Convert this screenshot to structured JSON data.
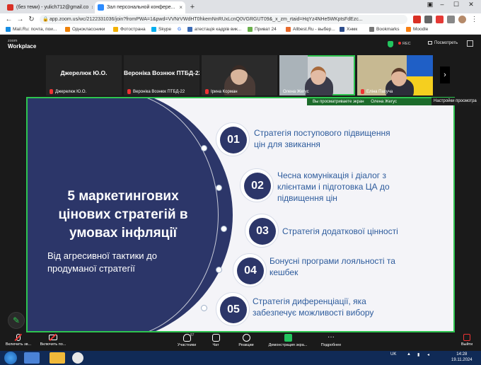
{
  "browser": {
    "tabs": [
      {
        "label": "(без теми) - yulich712@gmail.co",
        "favicon_color": "#d93025"
      },
      {
        "label": "Зал персональной конфере...",
        "favicon_color": "#2d8cff"
      }
    ],
    "new_tab": "+",
    "url": "app.zoom.us/wc/2122331036/join?fromPWA=1&pwd=VVNrVWdHT0hkemNnRUxLcnQ0VGRGUT09&_x_zm_rtaid=HqYz4NHe5WKptsFdEzc...",
    "bookmarks": [
      {
        "label": "Mail.Ru: почта, пои...",
        "color": "#168de2"
      },
      {
        "label": "Одноклассники",
        "color": "#ee8208"
      },
      {
        "label": "Фотострана",
        "color": "#f2b100"
      },
      {
        "label": "Skype",
        "color": "#00aff0"
      },
      {
        "label": "G",
        "color": "#4285f4"
      },
      {
        "label": "атестація кадрів вик...",
        "color": "#3b6bb5"
      },
      {
        "label": "Приват 24",
        "color": "#6ab04c"
      },
      {
        "label": "Allbest.Ru - выбер...",
        "color": "#e86a2c"
      },
      {
        "label": "Хнмк",
        "color": "#2d4d8c"
      },
      {
        "label": "Bookmarks",
        "color": "#777777"
      },
      {
        "label": "Moodle",
        "color": "#f98012"
      }
    ]
  },
  "zoom": {
    "brand": "zoom",
    "product": "Workplace",
    "rec": "REC",
    "view_label": "Посмотреть",
    "share_notice": "Вы просматриваете экран",
    "share_owner": "Олена Жегус",
    "settings_label": "Настройки просмотра",
    "next_arrow": "›",
    "participants": [
      {
        "big_name": "Джерелюк Ю.О.",
        "name": "Джерелюк Ю.О.",
        "video": false
      },
      {
        "big_name": "Вероніка Вознюк ПТБД-22",
        "name": "Вероніка Вознюк ПТБД-22",
        "video": false
      },
      {
        "big_name": "",
        "name": "Ірина Корман",
        "video": true
      },
      {
        "big_name": "",
        "name": "Олена Жегус",
        "video": true,
        "active": true
      },
      {
        "big_name": "",
        "name": "Еліна Пахуча",
        "video": true
      }
    ],
    "toolbar": {
      "mute": "Включить зв...",
      "video": "Включить по...",
      "participants": "Участники",
      "participants_count": "87",
      "chat": "Чат",
      "reactions": "Реакции",
      "share": "Демонстрация экра...",
      "more": "Подробнее",
      "exit": "Выйти"
    }
  },
  "slide": {
    "title": "5  маркетингових цінових стратегій в умовах інфляції",
    "subtitle": "Від агресивної тактики до продуманої стратегії",
    "items": [
      {
        "num": "01",
        "text": "Стратегія поступового підвищення цін для звикання"
      },
      {
        "num": "02",
        "text": "Чесна комунікація і діалог з клієнтами і підготовка ЦА до підвищення цін"
      },
      {
        "num": "03",
        "text": "Стратегія додаткової цінності"
      },
      {
        "num": "04",
        "text": "Бонусні програми лояльності та кешбек"
      },
      {
        "num": "05",
        "text": "Стратегія диференціації, яка забезпечує можливості вибору"
      }
    ]
  },
  "taskbar": {
    "lang": "UK",
    "time": "14:28",
    "date": "19.11.2024"
  }
}
